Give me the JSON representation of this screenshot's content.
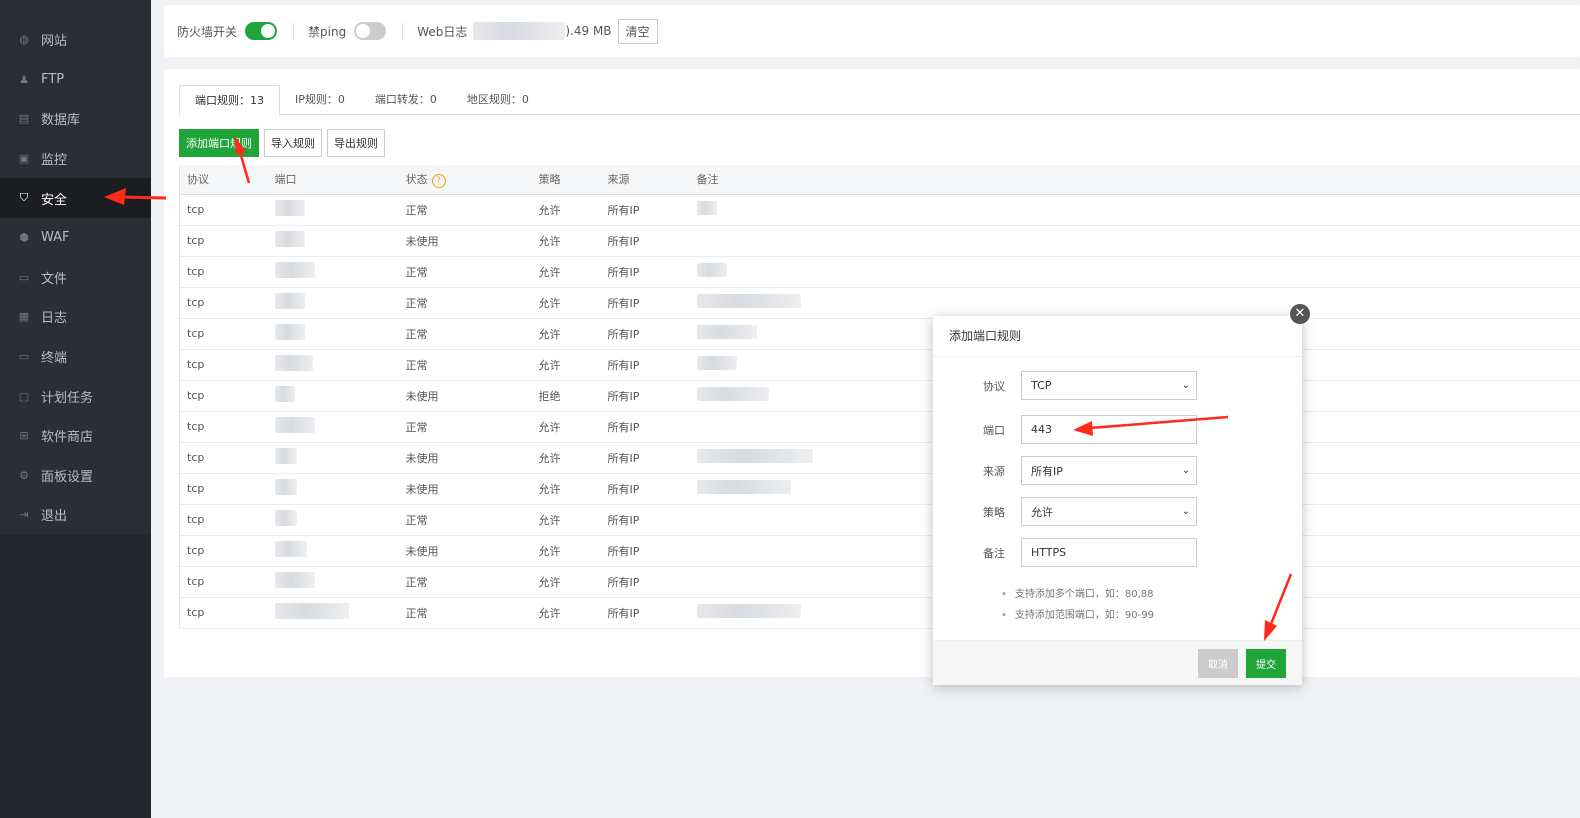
{
  "sidebar": {
    "items": [
      {
        "label": "网站",
        "icon": "globe-icon",
        "glyph": "◍"
      },
      {
        "label": "FTP",
        "icon": "user-icon",
        "glyph": "♟"
      },
      {
        "label": "数据库",
        "icon": "database-icon",
        "glyph": "▤"
      },
      {
        "label": "监控",
        "icon": "monitor-icon",
        "glyph": "▣"
      },
      {
        "label": "安全",
        "icon": "shield-icon",
        "glyph": "⛉"
      },
      {
        "label": "WAF",
        "icon": "waf-shield-icon",
        "glyph": "⬢"
      },
      {
        "label": "文件",
        "icon": "folder-icon",
        "glyph": "▭"
      },
      {
        "label": "日志",
        "icon": "log-icon",
        "glyph": "▦"
      },
      {
        "label": "终端",
        "icon": "terminal-icon",
        "glyph": "▭"
      },
      {
        "label": "计划任务",
        "icon": "calendar-icon",
        "glyph": "▢"
      },
      {
        "label": "软件商店",
        "icon": "apps-icon",
        "glyph": "⊞"
      },
      {
        "label": "面板设置",
        "icon": "gear-icon",
        "glyph": "⚙"
      },
      {
        "label": "退出",
        "icon": "logout-icon",
        "glyph": "⇥"
      }
    ],
    "active_index": 4
  },
  "topbar": {
    "firewall_label": "防火墙开关",
    "firewall_on": true,
    "ping_label": "禁ping",
    "ping_on": false,
    "weblog_label": "Web日志",
    "weblog_size": ").49 MB",
    "clear_label": "清空"
  },
  "tabs": [
    {
      "label": "端口规则：13"
    },
    {
      "label": "IP规则：0"
    },
    {
      "label": "端口转发：0"
    },
    {
      "label": "地区规则：0"
    }
  ],
  "toolbar": {
    "add_label": "添加端口规则",
    "import_label": "导入规则",
    "export_label": "导出规则"
  },
  "table": {
    "headers": {
      "protocol": "协议",
      "port": "端口",
      "status": "状态",
      "strategy": "策略",
      "source": "来源",
      "note": "备注"
    },
    "help_glyph": "?",
    "rows": [
      {
        "protocol": "tcp",
        "status": "正常",
        "strategy": "允许",
        "source": "所有IP"
      },
      {
        "protocol": "tcp",
        "status": "未使用",
        "strategy": "允许",
        "source": "所有IP"
      },
      {
        "protocol": "tcp",
        "status": "正常",
        "strategy": "允许",
        "source": "所有IP"
      },
      {
        "protocol": "tcp",
        "status": "正常",
        "strategy": "允许",
        "source": "所有IP"
      },
      {
        "protocol": "tcp",
        "status": "正常",
        "strategy": "允许",
        "source": "所有IP"
      },
      {
        "protocol": "tcp",
        "status": "正常",
        "strategy": "允许",
        "source": "所有IP"
      },
      {
        "protocol": "tcp",
        "status": "未使用",
        "strategy": "拒绝",
        "source": "所有IP"
      },
      {
        "protocol": "tcp",
        "status": "正常",
        "strategy": "允许",
        "source": "所有IP"
      },
      {
        "protocol": "tcp",
        "status": "未使用",
        "strategy": "允许",
        "source": "所有IP"
      },
      {
        "protocol": "tcp",
        "status": "未使用",
        "strategy": "允许",
        "source": "所有IP"
      },
      {
        "protocol": "tcp",
        "status": "正常",
        "strategy": "允许",
        "source": "所有IP"
      },
      {
        "protocol": "tcp",
        "status": "未使用",
        "strategy": "允许",
        "source": "所有IP"
      },
      {
        "protocol": "tcp",
        "status": "正常",
        "strategy": "允许",
        "source": "所有IP"
      },
      {
        "protocol": "tcp",
        "status": "正常",
        "strategy": "允许",
        "source": "所有IP"
      }
    ]
  },
  "modal": {
    "title": "添加端口规则",
    "close_glyph": "✕",
    "fields": {
      "protocol": {
        "label": "协议",
        "value": "TCP"
      },
      "port": {
        "label": "端口",
        "value": "443"
      },
      "source": {
        "label": "来源",
        "value": "所有IP"
      },
      "strategy": {
        "label": "策略",
        "value": "允许"
      },
      "note": {
        "label": "备注",
        "value": "HTTPS"
      }
    },
    "tips": [
      "支持添加多个端口，如：80,88",
      "支持添加范围端口，如：90-99"
    ],
    "cancel_label": "取消",
    "submit_label": "提交"
  },
  "colors": {
    "accent": "#20a53a",
    "deny": "#e53935",
    "annotation": "#ff2a1a"
  }
}
